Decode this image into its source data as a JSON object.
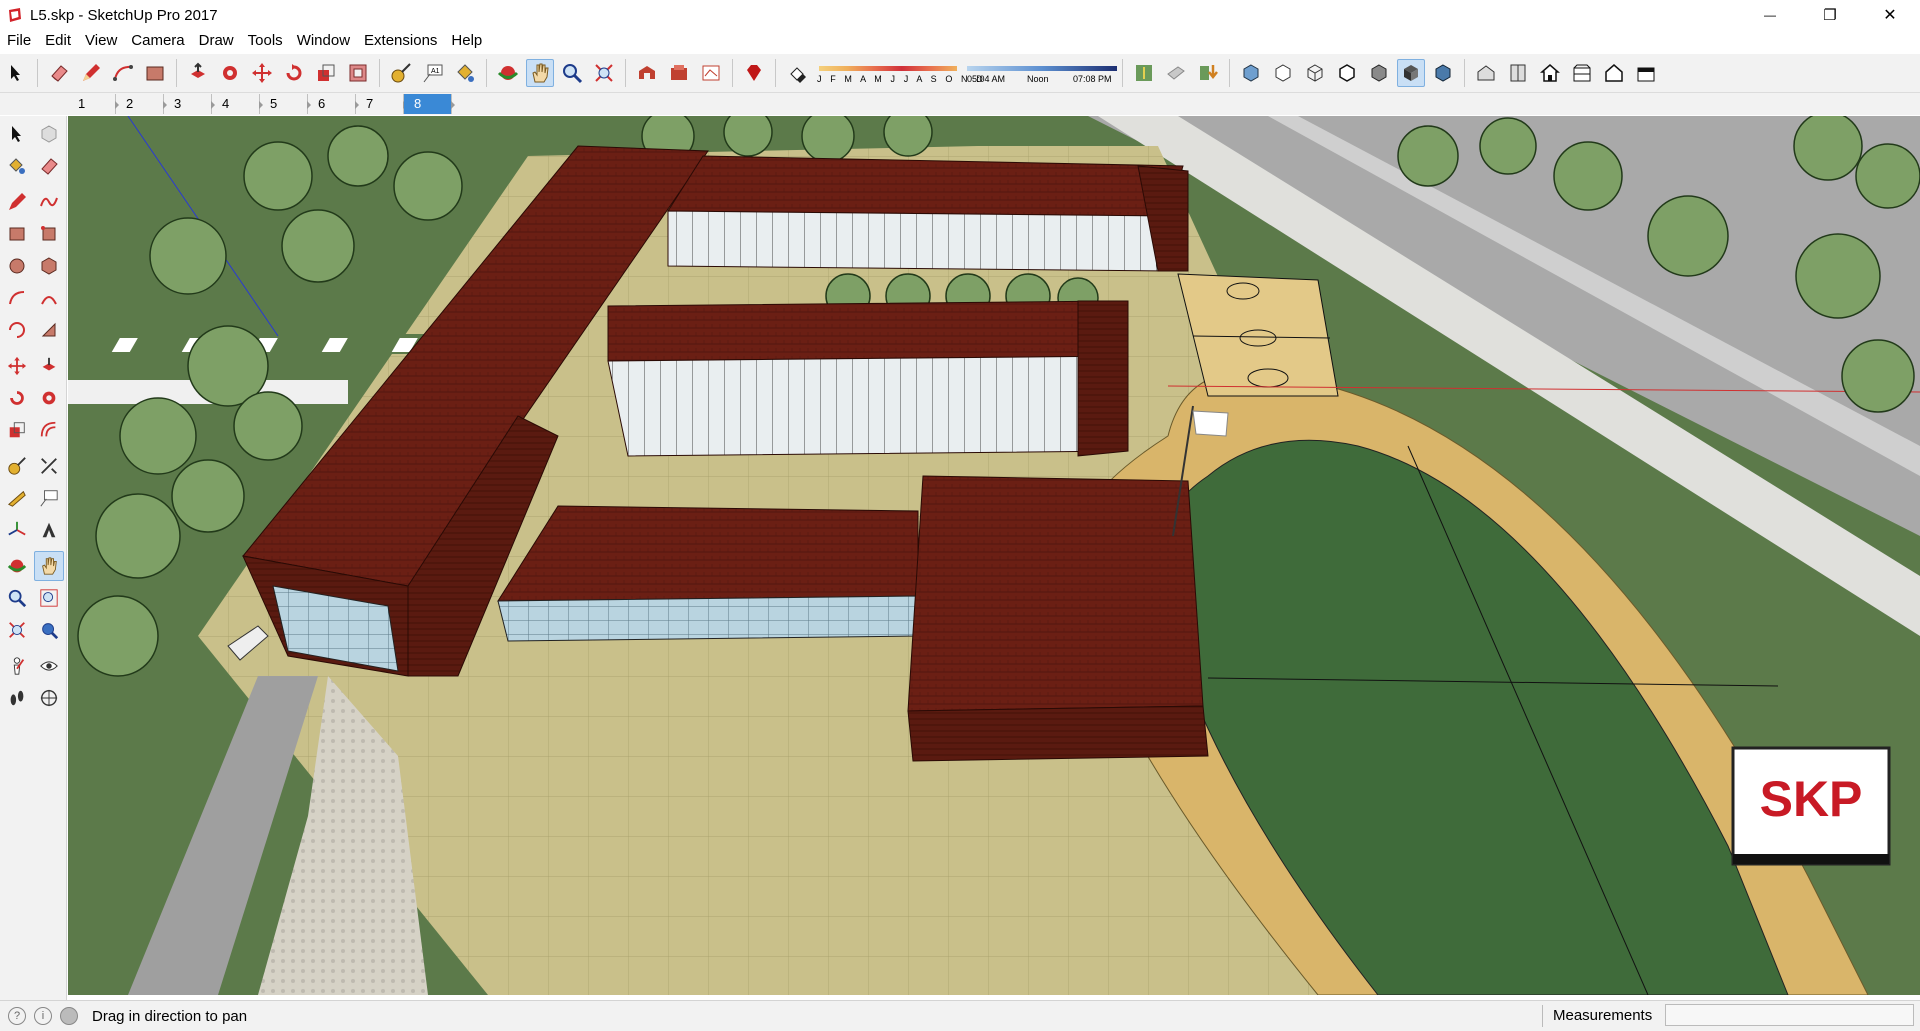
{
  "window": {
    "title": "L5.skp - SketchUp Pro 2017",
    "minimize_glyph": "—",
    "maximize_glyph": "❐",
    "close_glyph": "✕"
  },
  "menu": [
    "File",
    "Edit",
    "View",
    "Camera",
    "Draw",
    "Tools",
    "Window",
    "Extensions",
    "Help"
  ],
  "toolbar": {
    "months_label": "J F M A M J J A S O N D",
    "time_start": "05:04 AM",
    "time_mid": "Noon",
    "time_end": "07:08 PM",
    "active_tool": "pan"
  },
  "scenes": {
    "tabs": [
      "1",
      "2",
      "3",
      "4",
      "5",
      "6",
      "7",
      "8"
    ],
    "active_index": 7
  },
  "viewport": {
    "watermark": "SKP"
  },
  "status": {
    "hint": "Drag in direction to pan",
    "measurements_label": "Measurements",
    "measurements_value": ""
  },
  "colors": {
    "brick": "#6b1f14",
    "grass": "#5c7a4a",
    "track": "#d9b56a",
    "road": "#a9a9a9",
    "active_tab": "#3a89d6"
  }
}
